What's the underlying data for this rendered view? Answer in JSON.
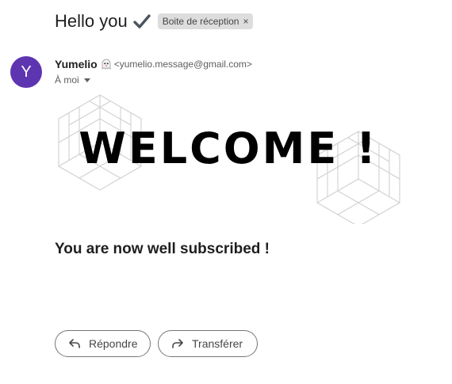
{
  "email": {
    "subject": "Hello you",
    "subject_icon": "check-mark-icon",
    "label": "Boite de réception",
    "label_close": "×",
    "sender": {
      "avatar_letter": "Y",
      "avatar_color": "#5e35b1",
      "name": "Yumelio",
      "name_icon": "ghost-icon",
      "email": "<yumelio.message@gmail.com>"
    },
    "recipient": "À moi",
    "body": {
      "headline": "WELCOME !",
      "message": "You are now well subscribed !"
    }
  },
  "actions": {
    "reply_label": "Répondre",
    "forward_label": "Transférer"
  }
}
